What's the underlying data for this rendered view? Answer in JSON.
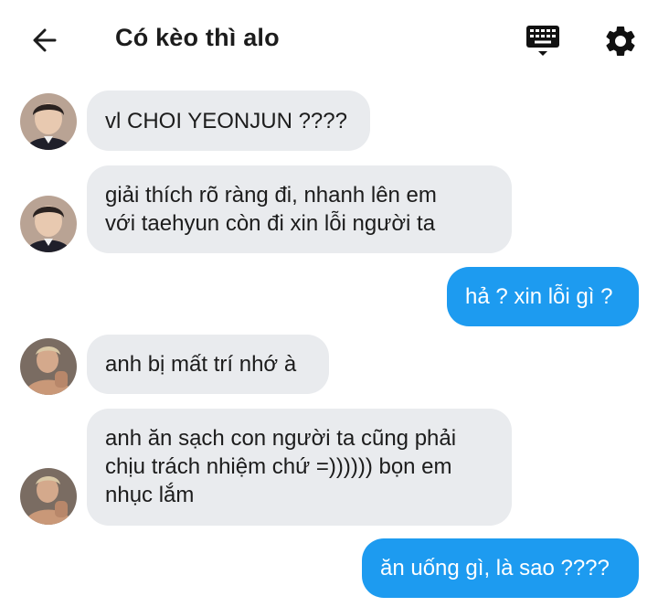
{
  "header": {
    "title": "Có kèo thì alo",
    "icons": [
      "back-arrow-icon",
      "keyboard-icon",
      "gear-icon"
    ]
  },
  "messages": [
    {
      "direction": "in",
      "sender": "avatar-a",
      "lines": [
        "vl CHOI YEONJUN ????"
      ]
    },
    {
      "direction": "in",
      "sender": "avatar-a",
      "lines": [
        "giải thích rõ ràng đi, nhanh lên em",
        "với taehyun còn đi xin lỗi người ta"
      ]
    },
    {
      "direction": "out",
      "lines": [
        "hả ? xin lỗi gì ?"
      ]
    },
    {
      "direction": "in",
      "sender": "avatar-b",
      "lines": [
        "anh bị mất trí nhớ à"
      ]
    },
    {
      "direction": "in",
      "sender": "avatar-b",
      "lines": [
        "anh ăn sạch con người ta cũng phải",
        "chịu trách nhiệm chứ =)))))) bọn em",
        "nhục lắm"
      ]
    },
    {
      "direction": "out",
      "lines": [
        "ăn uống gì, là sao ????"
      ]
    }
  ],
  "colors": {
    "incoming_bubble": "#e9ebee",
    "outgoing_bubble": "#1d9bf0",
    "text": "#1c1c1c"
  }
}
